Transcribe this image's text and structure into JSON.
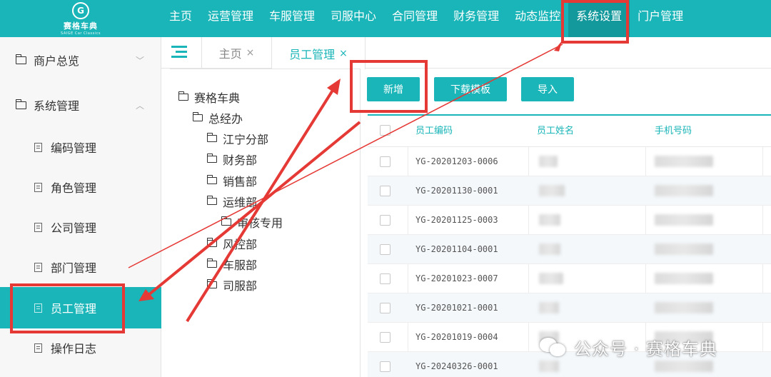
{
  "brand": {
    "logo_letter": "G",
    "name": "赛格车典",
    "subtitle": "SAIGE Car Classics"
  },
  "top_nav": [
    {
      "label": "主页",
      "active": false
    },
    {
      "label": "运营管理",
      "active": false
    },
    {
      "label": "车服管理",
      "active": false
    },
    {
      "label": "司服中心",
      "active": false
    },
    {
      "label": "合同管理",
      "active": false
    },
    {
      "label": "财务管理",
      "active": false
    },
    {
      "label": "动态监控",
      "active": false
    },
    {
      "label": "系统设置",
      "active": true
    },
    {
      "label": "门户管理",
      "active": false
    }
  ],
  "sidebar": {
    "groups": [
      {
        "label": "商户总览",
        "chevron": "﹀"
      },
      {
        "label": "系统管理",
        "chevron": "︿"
      }
    ],
    "items": [
      {
        "label": "编码管理",
        "active": false
      },
      {
        "label": "角色管理",
        "active": false
      },
      {
        "label": "公司管理",
        "active": false
      },
      {
        "label": "部门管理",
        "active": false
      },
      {
        "label": "员工管理",
        "active": true
      },
      {
        "label": "操作日志",
        "active": false
      }
    ]
  },
  "tabs": [
    {
      "label": "主页",
      "close": "×",
      "active": false
    },
    {
      "label": "员工管理",
      "close": "×",
      "active": true
    }
  ],
  "tree": [
    {
      "label": "赛格车典",
      "level": 0
    },
    {
      "label": "总经办",
      "level": 1
    },
    {
      "label": "江宁分部",
      "level": 2
    },
    {
      "label": "财务部",
      "level": 2
    },
    {
      "label": "销售部",
      "level": 2
    },
    {
      "label": "运维部",
      "level": 2
    },
    {
      "label": "审核专用",
      "level": 3
    },
    {
      "label": "风控部",
      "level": 2
    },
    {
      "label": "车服部",
      "level": 2
    },
    {
      "label": "司服部",
      "level": 2
    }
  ],
  "toolbar": {
    "add_label": "新增",
    "download_label": "下载模板",
    "import_label": "导入"
  },
  "table": {
    "columns": [
      "员工编码",
      "员工姓名",
      "手机号码"
    ],
    "rows": [
      "YG-20201203-0006",
      "YG-20201130-0001",
      "YG-20201125-0003",
      "YG-20201104-0001",
      "YG-20201023-0007",
      "YG-20201021-0001",
      "YG-20201019-0004",
      "YG-20240326-0001"
    ]
  },
  "watermark": {
    "text": "公众号 · 赛格车典",
    "icon": "wechat-icon"
  },
  "colors": {
    "primary": "#1ab5b8",
    "active_nav": "#13999c",
    "annotation_red": "#e53935"
  }
}
